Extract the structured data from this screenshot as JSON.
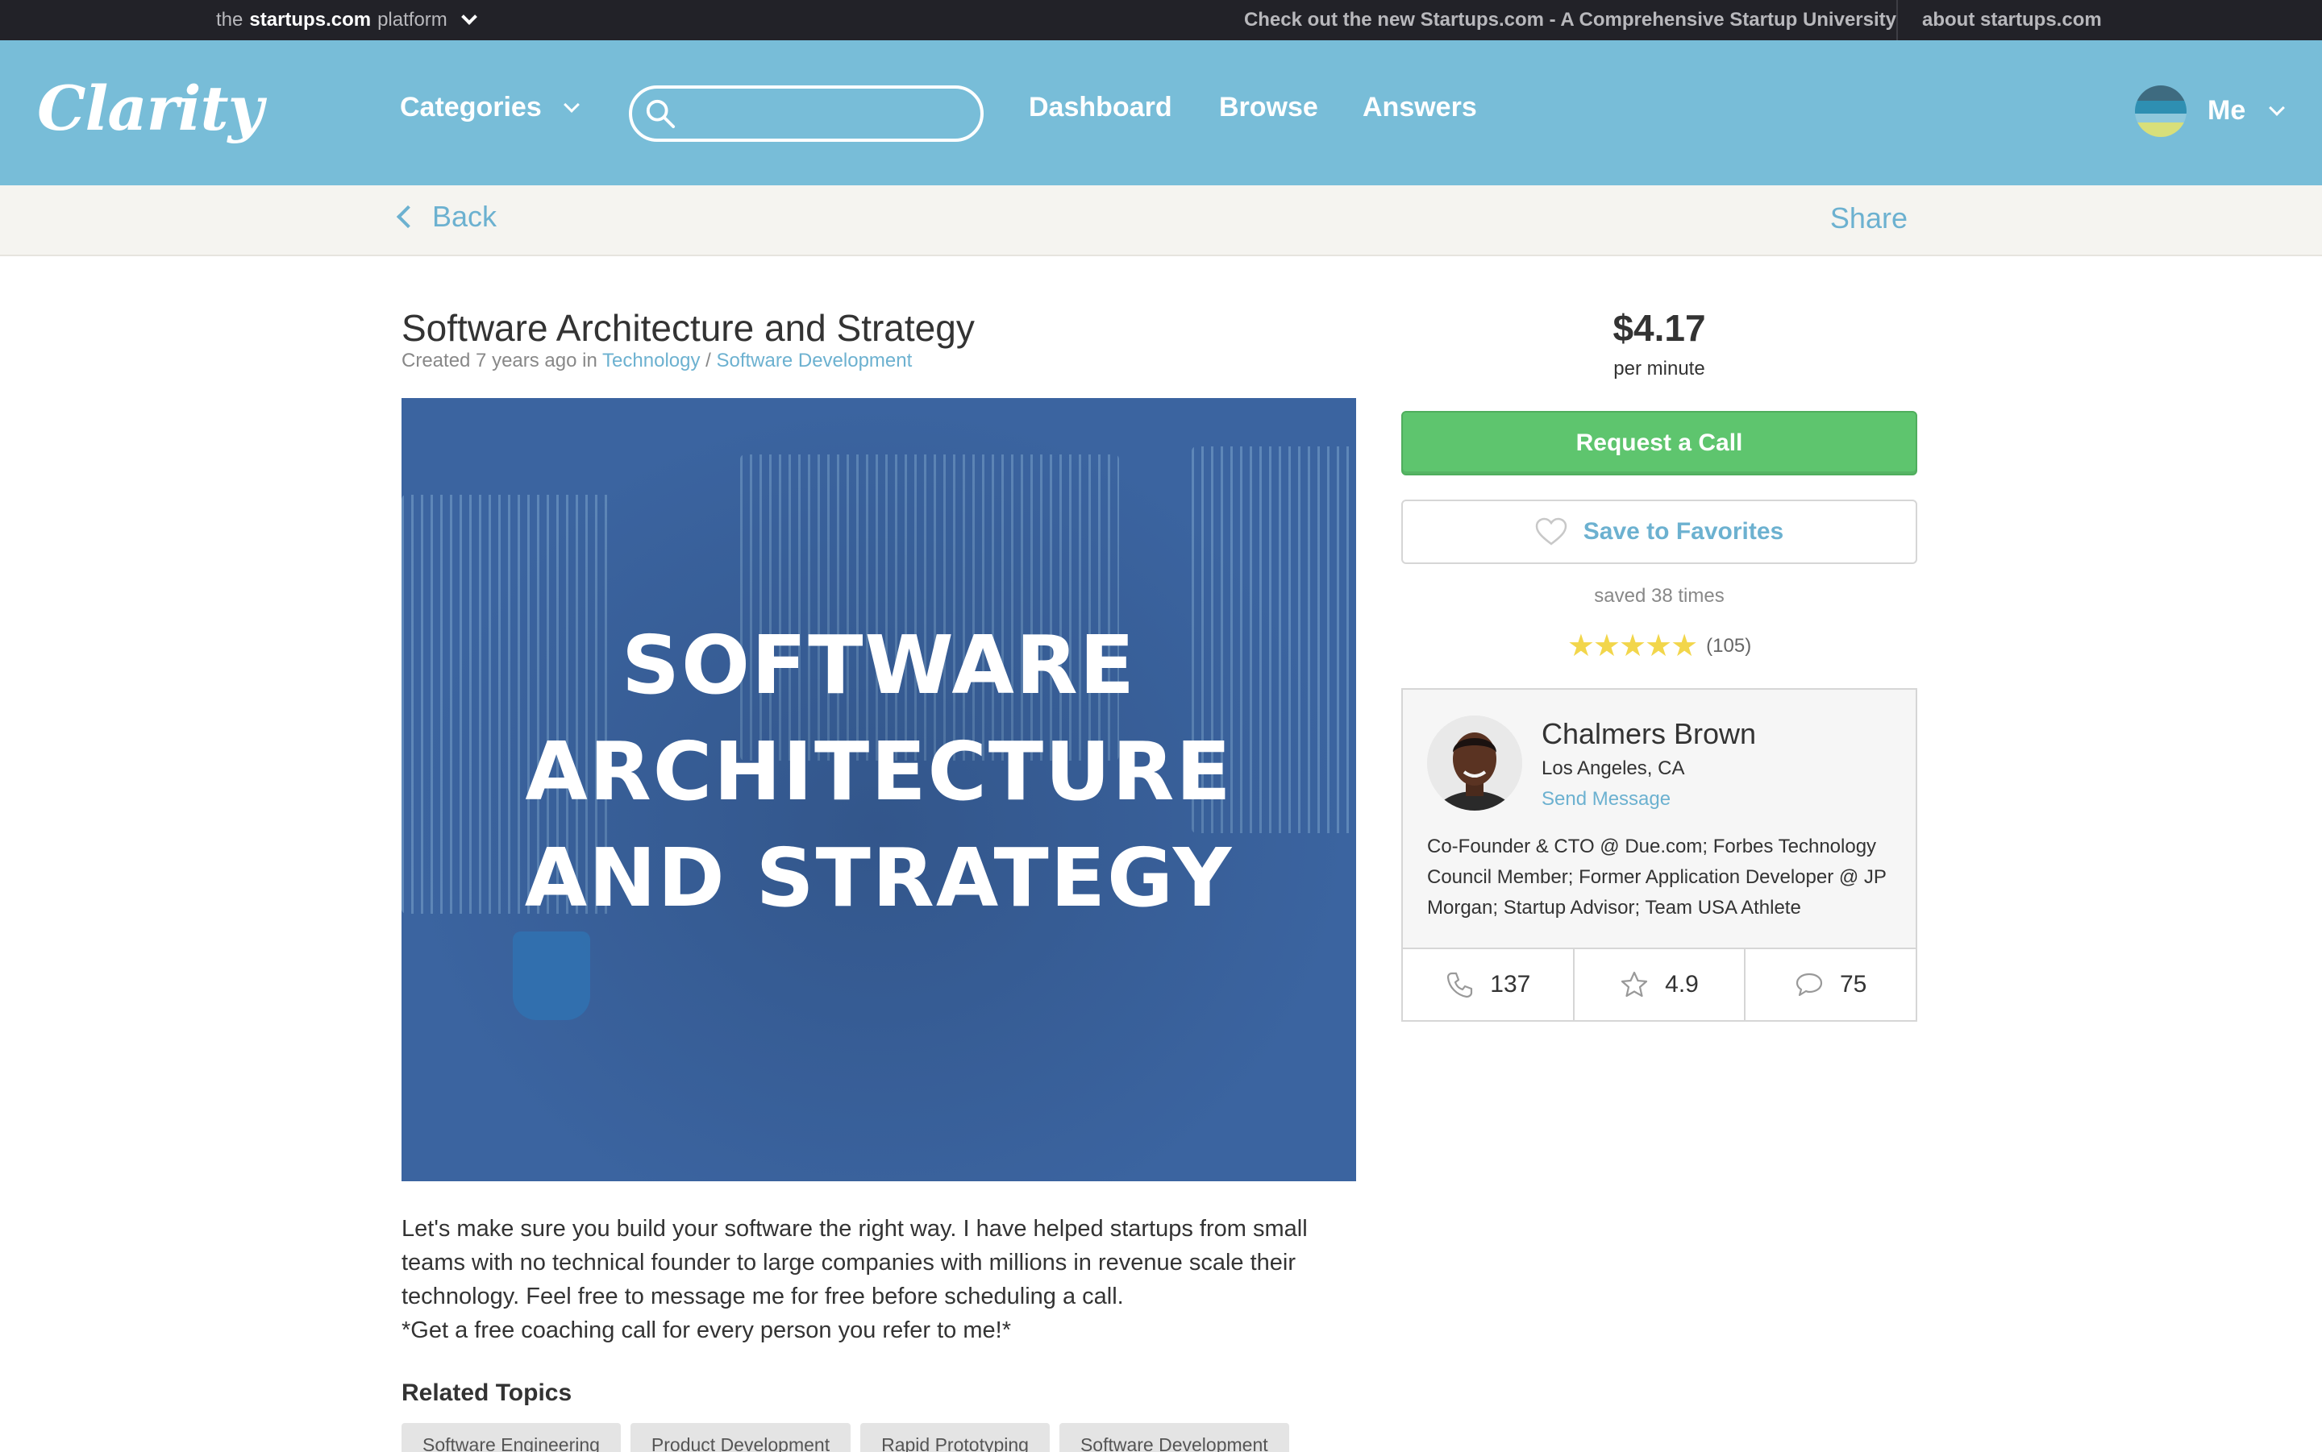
{
  "topbar": {
    "platform_prefix": "the",
    "platform_brand": "startups.com",
    "platform_suffix": "platform",
    "promo": "Check out the new Startups.com - A Comprehensive Startup University",
    "about": "about startups.com"
  },
  "header": {
    "logo": "Clarity",
    "categories": "Categories",
    "search_placeholder": "",
    "nav": [
      "Dashboard",
      "Browse",
      "Answers"
    ],
    "me": "Me"
  },
  "subbar": {
    "back": "Back",
    "share": "Share"
  },
  "topic": {
    "title": "Software Architecture and Strategy",
    "created": "Created 7 years ago in",
    "category": "Technology",
    "separator": " / ",
    "subcategory": "Software Development",
    "hero_lines": [
      "SOFTWARE",
      "ARCHITECTURE",
      "AND STRATEGY"
    ],
    "description": [
      "Let's make sure you build your software the right way. I have helped startups from small teams with no technical founder to large companies with millions in revenue scale their technology. Feel free to message me for free before scheduling a call.",
      "*Get a free coaching call for every person you refer to me!*"
    ],
    "related_title": "Related Topics",
    "related_tags": [
      "Software Engineering",
      "Product Development",
      "Rapid Prototyping",
      "Software Development"
    ]
  },
  "pricing": {
    "price": "$4.17",
    "unit": "per minute",
    "request_call": "Request a Call",
    "save_favorites": "Save to Favorites",
    "saved_count": "saved 38 times",
    "stars": "★★★★★",
    "rating_value": 5,
    "review_count": "(105)"
  },
  "expert": {
    "name": "Chalmers Brown",
    "location": "Los Angeles, CA",
    "send_message": "Send Message",
    "bio": "Co-Founder & CTO @ Due.com; Forbes Technology Council Member; Former Application Developer @ JP Morgan; Startup Advisor; Team USA Athlete",
    "stats": {
      "calls": "137",
      "rating": "4.9",
      "reviews": "75"
    }
  },
  "colors": {
    "header_bg": "#78bdd8",
    "topbar_bg": "#222228",
    "link": "#6cb1d0",
    "call_button": "#5ec56e",
    "hero_bg": "#3b64a0",
    "stars": "#f2d64b"
  }
}
